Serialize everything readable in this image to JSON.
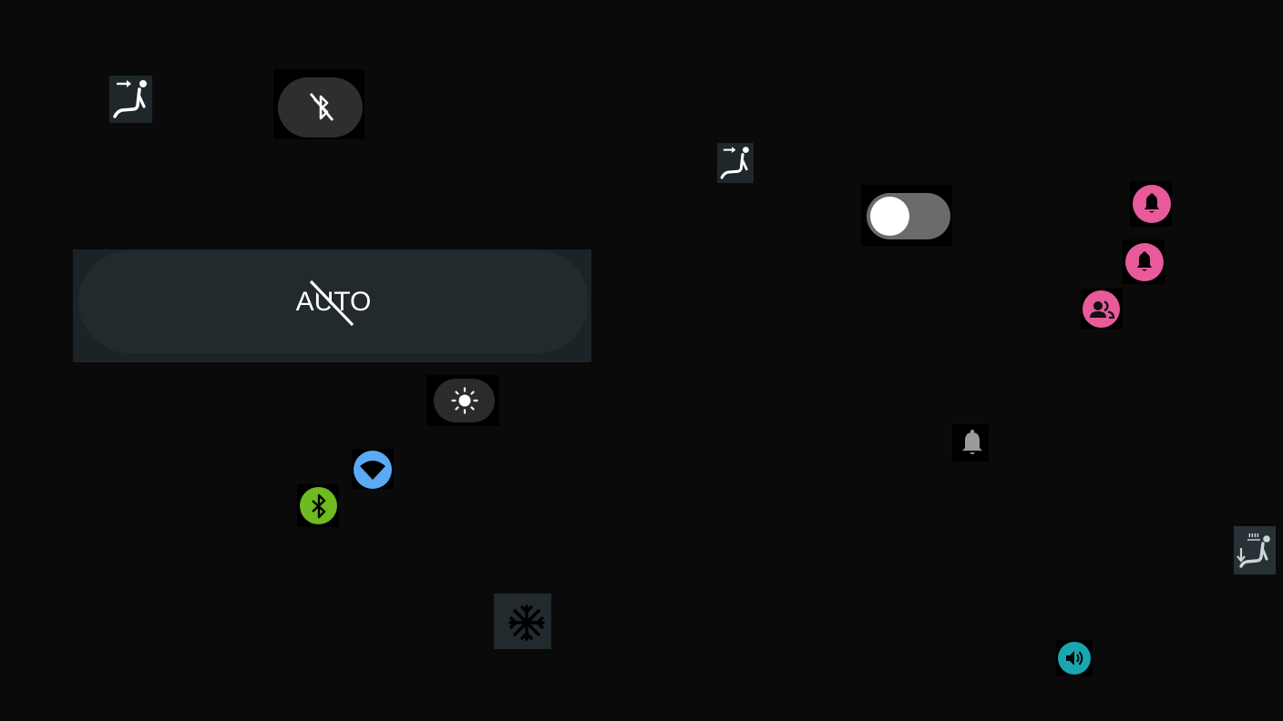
{
  "colors": {
    "background": "#0a0a0a",
    "pink": "#e85a9a",
    "blue": "#5aaaf5",
    "green": "#6fba1e",
    "teal": "#1aa6b0",
    "tile": "#1f272b",
    "toggle_track": "#6b6b6b"
  },
  "controls": {
    "seat_airflow_top_left": {
      "icon": "seat-airflow-forward-icon"
    },
    "bluetooth_off": {
      "icon": "bluetooth-disabled-icon"
    },
    "seat_airflow_mid": {
      "icon": "seat-airflow-forward-icon"
    },
    "toggle": {
      "state": "off"
    },
    "notification_1": {
      "icon": "bell-icon"
    },
    "notification_2": {
      "icon": "bell-icon"
    },
    "people": {
      "icon": "people-icon"
    },
    "auto_button": {
      "label": "AUTO",
      "state": "disabled"
    },
    "brightness": {
      "icon": "sun-icon"
    },
    "wifi": {
      "icon": "wifi-icon"
    },
    "bluetooth_on": {
      "icon": "bluetooth-icon"
    },
    "bell_gray": {
      "icon": "bell-icon"
    },
    "seat_heat": {
      "icon": "seat-heat-down-icon"
    },
    "ac_snowflake": {
      "icon": "snowflake-icon"
    },
    "volume": {
      "icon": "volume-icon"
    }
  }
}
